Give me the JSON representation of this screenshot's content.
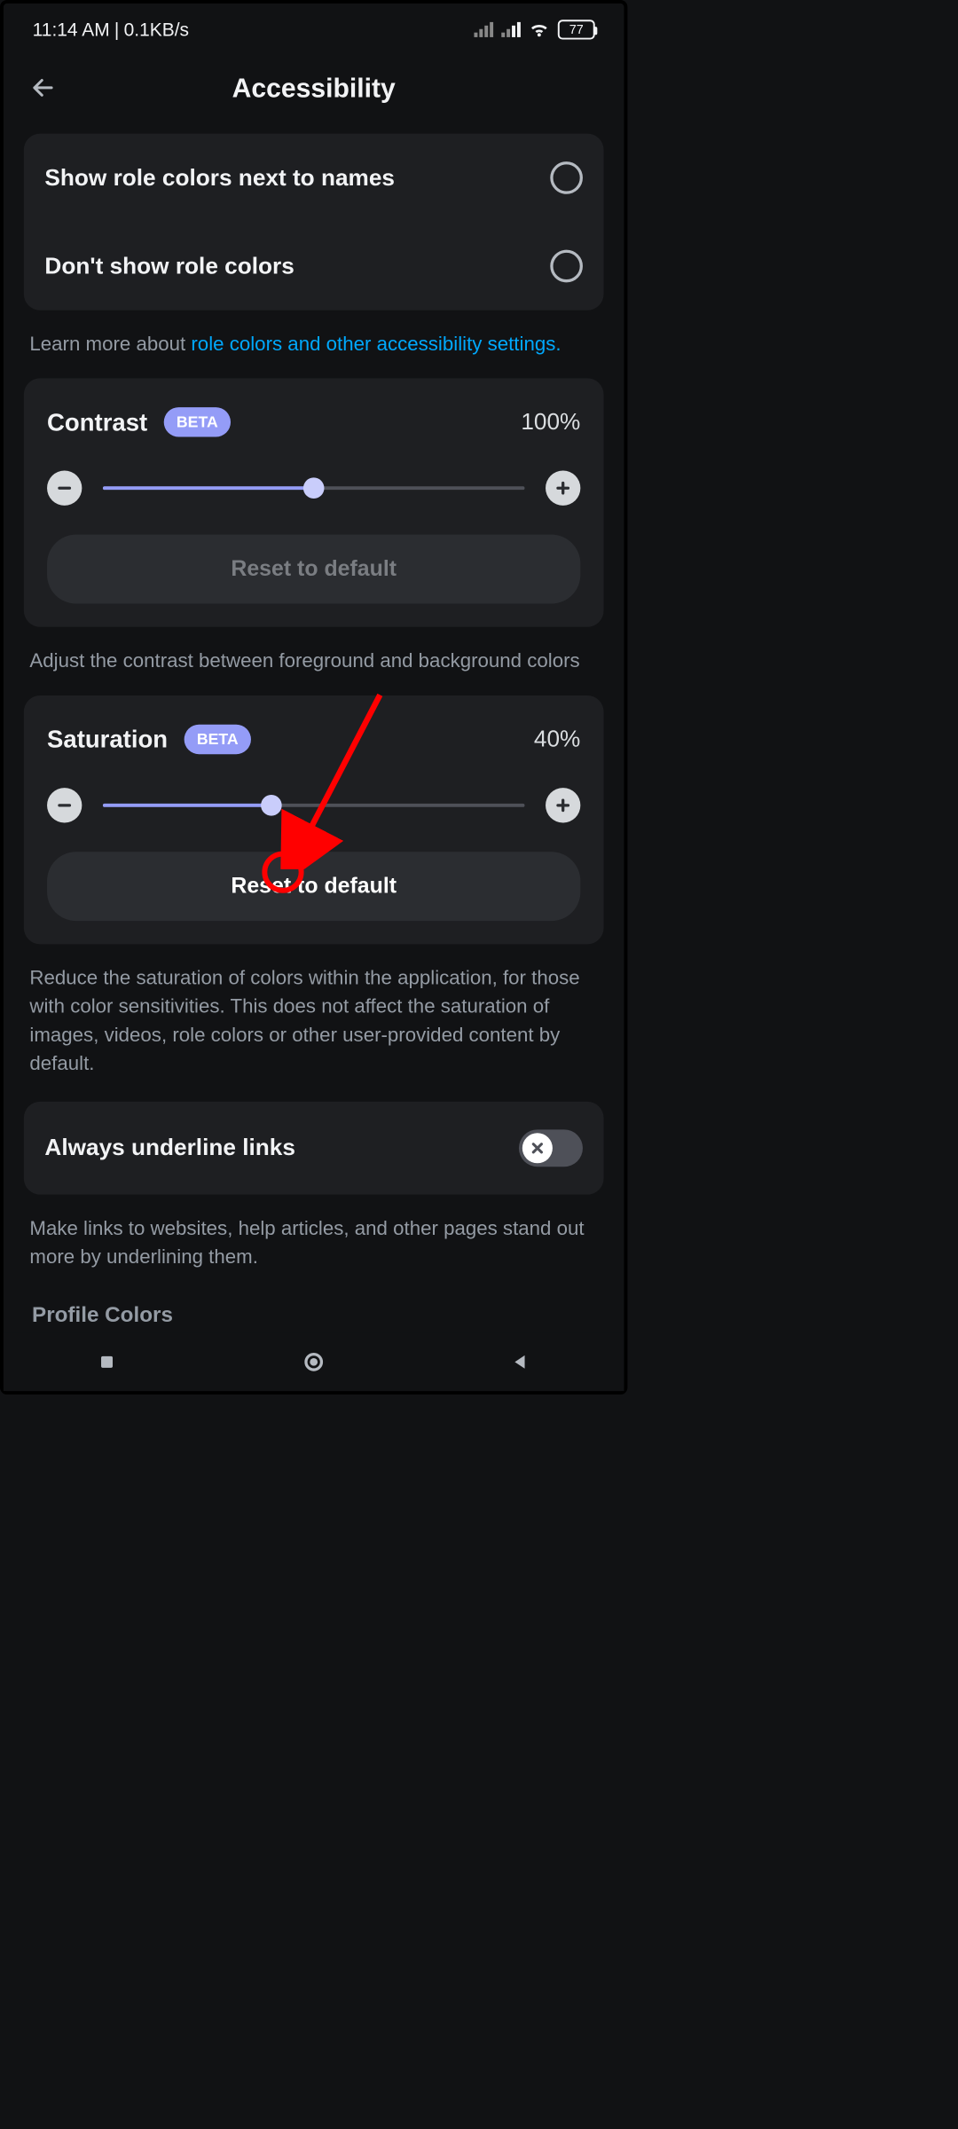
{
  "status_bar": {
    "time": "11:14 AM",
    "speed": "0.1KB/s",
    "battery": "77"
  },
  "header": {
    "title": "Accessibility"
  },
  "role_colors": {
    "option1": "Show role colors next to names",
    "option2": "Don't show role colors",
    "hint_prefix": "Learn more about ",
    "hint_link": "role colors and other accessibility settings."
  },
  "contrast": {
    "title": "Contrast",
    "badge": "BETA",
    "value": "100%",
    "fill_percent": 50,
    "reset": "Reset to default",
    "hint": "Adjust the contrast between foreground and background colors"
  },
  "saturation": {
    "title": "Saturation",
    "badge": "BETA",
    "value": "40%",
    "fill_percent": 40,
    "reset": "Reset to default",
    "hint": "Reduce the saturation of colors within the application, for those with color sensitivities. This does not affect the saturation of images, videos, role colors or other user-provided content by default."
  },
  "underline_links": {
    "title": "Always underline links",
    "hint": "Make links to websites, help articles, and other pages stand out more by underlining them."
  },
  "profile_colors_heading": "Profile Colors"
}
